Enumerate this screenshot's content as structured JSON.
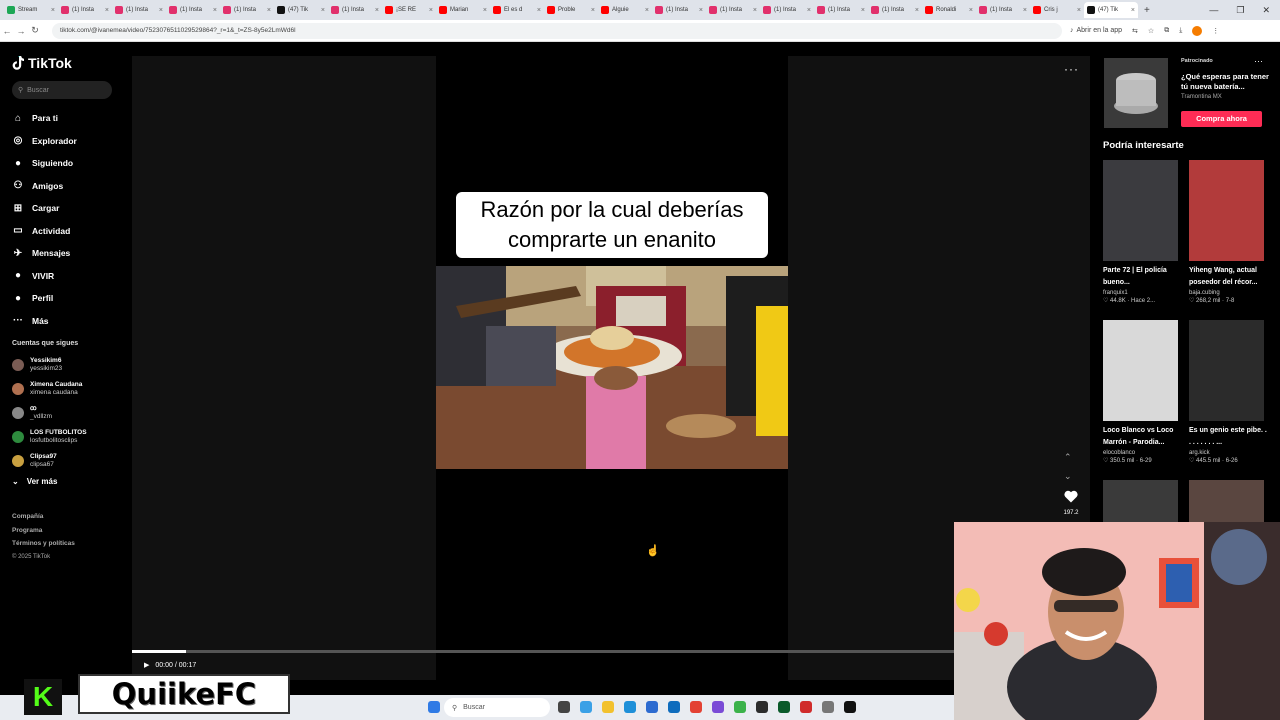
{
  "browser": {
    "tabs": [
      {
        "label": "Stream",
        "color": "#1da756"
      },
      {
        "label": "(1) Insta",
        "color": "#e1306c"
      },
      {
        "label": "(1) Insta",
        "color": "#e1306c"
      },
      {
        "label": "(1) Insta",
        "color": "#e1306c"
      },
      {
        "label": "(1) Insta",
        "color": "#e1306c"
      },
      {
        "label": "(47) Tik",
        "color": "#111111"
      },
      {
        "label": "(1) Insta",
        "color": "#e1306c"
      },
      {
        "label": "¡SE RE",
        "color": "#ff0000"
      },
      {
        "label": "Marian",
        "color": "#ff0000"
      },
      {
        "label": "El es d",
        "color": "#ff0000"
      },
      {
        "label": "Proble",
        "color": "#ff0000"
      },
      {
        "label": "Alguie",
        "color": "#ff0000"
      },
      {
        "label": "(1) Insta",
        "color": "#e1306c"
      },
      {
        "label": "(1) Insta",
        "color": "#e1306c"
      },
      {
        "label": "(1) Insta",
        "color": "#e1306c"
      },
      {
        "label": "(1) Insta",
        "color": "#e1306c"
      },
      {
        "label": "(1) Insta",
        "color": "#e1306c"
      },
      {
        "label": "Ronaldi",
        "color": "#ff0000"
      },
      {
        "label": "(1) Insta",
        "color": "#e1306c"
      },
      {
        "label": "Cris j",
        "color": "#ff0000"
      },
      {
        "label": "(47) Tik",
        "color": "#111111",
        "active": true
      }
    ],
    "url": "tiktok.com/@ivanemea/video/7523076511029529864?_r=1&_t=ZS-8y5e2LmWd6l",
    "open_app_label": "Abrir en la app"
  },
  "sidebar": {
    "logo": "TikTok",
    "search_placeholder": "Buscar",
    "menu": [
      {
        "label": "Para ti",
        "icon": "home-icon",
        "glyph": "⌂"
      },
      {
        "label": "Explorador",
        "icon": "compass-icon",
        "glyph": "◎"
      },
      {
        "label": "Siguiendo",
        "icon": "following-icon",
        "glyph": "●"
      },
      {
        "label": "Amigos",
        "icon": "friends-icon",
        "glyph": "⚇"
      },
      {
        "label": "Cargar",
        "icon": "upload-icon",
        "glyph": "⊞"
      },
      {
        "label": "Actividad",
        "icon": "activity-icon",
        "glyph": "▭"
      },
      {
        "label": "Mensajes",
        "icon": "messages-icon",
        "glyph": "✈"
      },
      {
        "label": "VIVIR",
        "icon": "live-icon",
        "glyph": "●"
      },
      {
        "label": "Perfil",
        "icon": "profile-icon",
        "glyph": "●"
      },
      {
        "label": "Más",
        "icon": "more-icon",
        "glyph": "···"
      }
    ],
    "following_title": "Cuentas que sigues",
    "accounts": [
      {
        "name": "Yessikim6",
        "handle": "yessikim23",
        "color": "#7a5c54"
      },
      {
        "name": "Ximena Caudana",
        "handle": "ximena caudana",
        "color": "#b07050"
      },
      {
        "name": "ꚙ",
        "handle": "_vdllzm",
        "color": "#888888"
      },
      {
        "name": "LOS FUTBOLITOS",
        "handle": "losfutbolitosclips",
        "color": "#2e8b3e"
      },
      {
        "name": "Clipsa97",
        "handle": "clipsa67",
        "color": "#c9a040"
      }
    ],
    "see_more": "Ver más",
    "footer": [
      "Compañía",
      "Programa",
      "Términos y políticas"
    ],
    "copyright": "© 2025 TikTok"
  },
  "video": {
    "caption_line1": "Razón por la cual deberías",
    "caption_line2": "comprarte un enanito",
    "time": "00:00 / 00:17",
    "progress": 0.066,
    "likes": "197.2"
  },
  "right": {
    "sponsored": "Patrocinado",
    "ad_title": "¿Qué esperas para tener tú nueva batería...",
    "ad_brand": "Tramontina MX",
    "ad_button": "Compra ahora",
    "rec_title": "Podría interesarte",
    "cards": [
      {
        "title": "Parte 72 | El policía bueno...",
        "author": "franquix1",
        "stats": "♡ 44.8K · Hace 2...",
        "bg": "#3b3b3f"
      },
      {
        "title": "Yiheng Wang, actual poseedor del récor...",
        "author": "baja.cubing",
        "stats": "♡ 268,2 mil · 7-8",
        "bg": "#b23b3b"
      },
      {
        "title": "Loco Blanco vs Loco Marrón - Parodia...",
        "author": "elocoblanco",
        "stats": "♡ 350.5 mil · 6-29",
        "bg": "#d9d9d9"
      },
      {
        "title": "Es un genio este pibe. . . . . . . . . ...",
        "author": "arg.kick",
        "stats": "♡ 445.5 mil · 6-26",
        "bg": "#2b2b2b"
      }
    ]
  },
  "taskbar": {
    "search_placeholder": "Buscar"
  },
  "overlay": {
    "k_logo": "K",
    "streamer_name": "QuiikeFC"
  }
}
